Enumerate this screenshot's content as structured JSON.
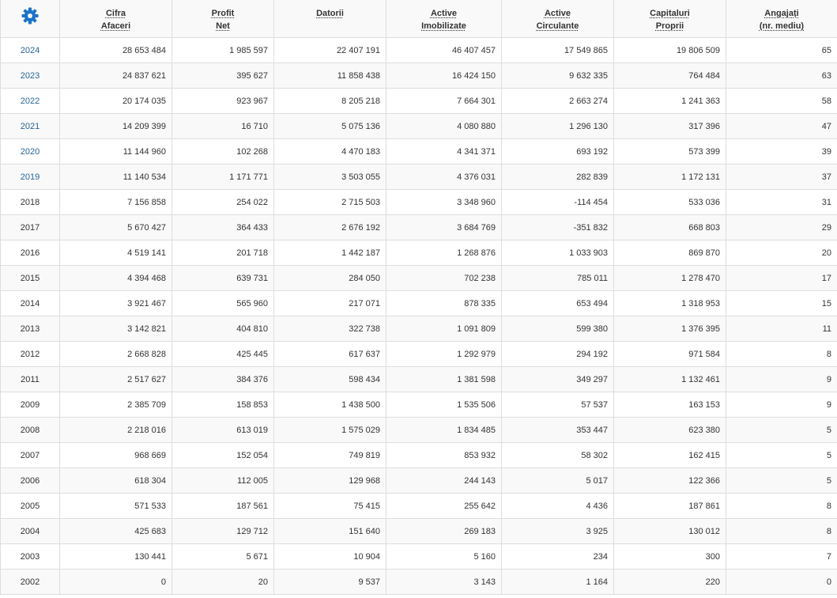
{
  "settings": {
    "icon": "gear-icon",
    "color": "#1a73c8"
  },
  "columns": [
    {
      "line1": "Cifra",
      "line2": "Afaceri"
    },
    {
      "line1": "Profit",
      "line2": "Net"
    },
    {
      "line1": "Datorii",
      "line2": ""
    },
    {
      "line1": "Active",
      "line2": "Imobilizate"
    },
    {
      "line1": "Active",
      "line2": "Circulante"
    },
    {
      "line1": "Capitaluri",
      "line2": "Proprii"
    },
    {
      "line1": "Angajați",
      "line2": "(nr. mediu)"
    }
  ],
  "rows": [
    {
      "year": "2024",
      "linked": true,
      "values": [
        "28 653 484",
        "1 985 597",
        "22 407 191",
        "46 407 457",
        "17 549 865",
        "19 806 509",
        "65"
      ]
    },
    {
      "year": "2023",
      "linked": true,
      "values": [
        "24 837 621",
        "395 627",
        "11 858 438",
        "16 424 150",
        "9 632 335",
        "764 484",
        "63"
      ]
    },
    {
      "year": "2022",
      "linked": true,
      "values": [
        "20 174 035",
        "923 967",
        "8 205 218",
        "7 664 301",
        "2 663 274",
        "1 241 363",
        "58"
      ]
    },
    {
      "year": "2021",
      "linked": true,
      "values": [
        "14 209 399",
        "16 710",
        "5 075 136",
        "4 080 880",
        "1 296 130",
        "317 396",
        "47"
      ]
    },
    {
      "year": "2020",
      "linked": true,
      "values": [
        "11 144 960",
        "102 268",
        "4 470 183",
        "4 341 371",
        "693 192",
        "573 399",
        "39"
      ]
    },
    {
      "year": "2019",
      "linked": true,
      "values": [
        "11 140 534",
        "1 171 771",
        "3 503 055",
        "4 376 031",
        "282 839",
        "1 172 131",
        "37"
      ]
    },
    {
      "year": "2018",
      "linked": false,
      "values": [
        "7 156 858",
        "254 022",
        "2 715 503",
        "3 348 960",
        "-114 454",
        "533 036",
        "31"
      ]
    },
    {
      "year": "2017",
      "linked": false,
      "values": [
        "5 670 427",
        "364 433",
        "2 676 192",
        "3 684 769",
        "-351 832",
        "668 803",
        "29"
      ]
    },
    {
      "year": "2016",
      "linked": false,
      "values": [
        "4 519 141",
        "201 718",
        "1 442 187",
        "1 268 876",
        "1 033 903",
        "869 870",
        "20"
      ]
    },
    {
      "year": "2015",
      "linked": false,
      "values": [
        "4 394 468",
        "639 731",
        "284 050",
        "702 238",
        "785 011",
        "1 278 470",
        "17"
      ]
    },
    {
      "year": "2014",
      "linked": false,
      "values": [
        "3 921 467",
        "565 960",
        "217 071",
        "878 335",
        "653 494",
        "1 318 953",
        "15"
      ]
    },
    {
      "year": "2013",
      "linked": false,
      "values": [
        "3 142 821",
        "404 810",
        "322 738",
        "1 091 809",
        "599 380",
        "1 376 395",
        "11"
      ]
    },
    {
      "year": "2012",
      "linked": false,
      "values": [
        "2 668 828",
        "425 445",
        "617 637",
        "1 292 979",
        "294 192",
        "971 584",
        "8"
      ]
    },
    {
      "year": "2011",
      "linked": false,
      "values": [
        "2 517 627",
        "384 376",
        "598 434",
        "1 381 598",
        "349 297",
        "1 132 461",
        "9"
      ]
    },
    {
      "year": "2009",
      "linked": false,
      "values": [
        "2 385 709",
        "158 853",
        "1 438 500",
        "1 535 506",
        "57 537",
        "163 153",
        "9"
      ]
    },
    {
      "year": "2008",
      "linked": false,
      "values": [
        "2 218 016",
        "613 019",
        "1 575 029",
        "1 834 485",
        "353 447",
        "623 380",
        "5"
      ]
    },
    {
      "year": "2007",
      "linked": false,
      "values": [
        "968 669",
        "152 054",
        "749 819",
        "853 932",
        "58 302",
        "162 415",
        "5"
      ]
    },
    {
      "year": "2006",
      "linked": false,
      "values": [
        "618 304",
        "112 005",
        "129 968",
        "244 143",
        "5 017",
        "122 366",
        "5"
      ]
    },
    {
      "year": "2005",
      "linked": false,
      "values": [
        "571 533",
        "187 561",
        "75 415",
        "255 642",
        "4 436",
        "187 861",
        "8"
      ]
    },
    {
      "year": "2004",
      "linked": false,
      "values": [
        "425 683",
        "129 712",
        "151 640",
        "269 183",
        "3 925",
        "130 012",
        "8"
      ]
    },
    {
      "year": "2003",
      "linked": false,
      "values": [
        "130 441",
        "5 671",
        "10 904",
        "5 160",
        "234",
        "300",
        "7"
      ]
    },
    {
      "year": "2002",
      "linked": false,
      "values": [
        "0",
        "20",
        "9 537",
        "3 143",
        "1 164",
        "220",
        "0"
      ]
    }
  ],
  "theme": {
    "link_color": "#2a6496",
    "border_color": "#dddddd",
    "stripe_color": "#f9f9f9"
  }
}
